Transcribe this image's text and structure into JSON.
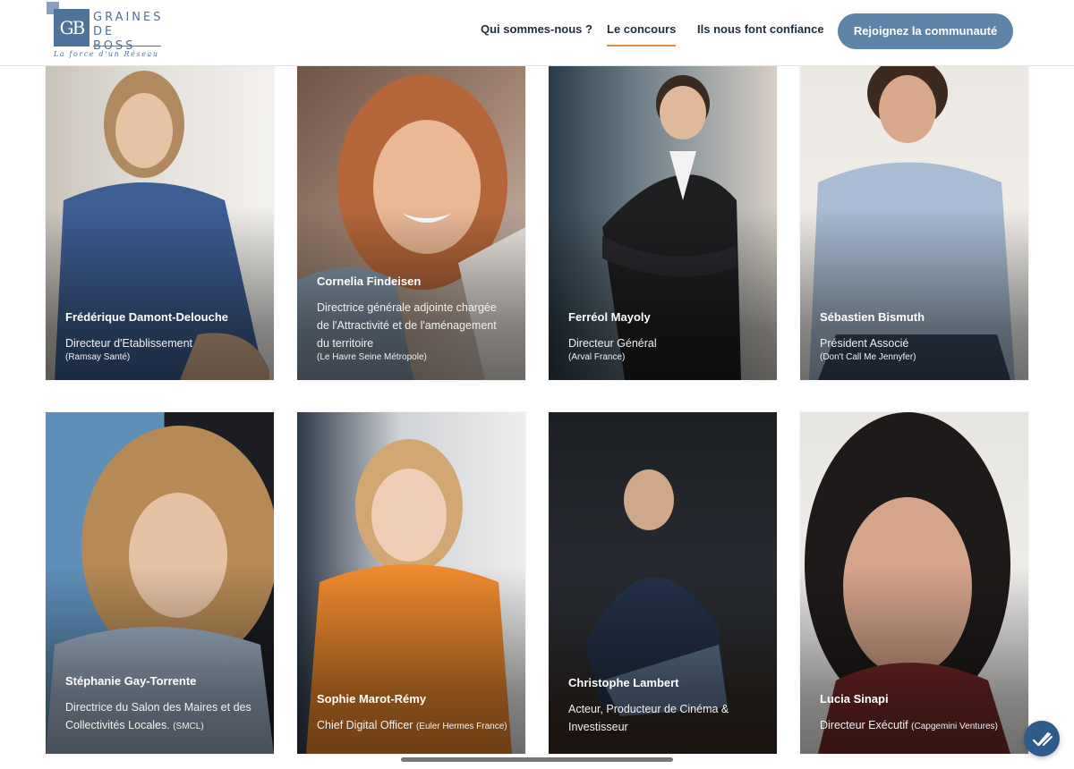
{
  "header": {
    "logo": {
      "monogram": "GB",
      "line1": "GRAINES",
      "line2": "DE BOSS",
      "tagline": "La force d'un Réseau"
    },
    "nav": [
      {
        "label": "Qui sommes-nous ?",
        "active": false
      },
      {
        "label": "Le concours",
        "active": true
      },
      {
        "label": "Ils nous font confiance",
        "active": false
      }
    ],
    "cta_label": "Rejoignez la communauté"
  },
  "colors": {
    "brand": "#4f729b",
    "cta": "#5b84a8",
    "nav_active_underline": "#e38b4a",
    "fab": "#2d5b8a"
  },
  "cards": [
    {
      "name": "Frédérique Damont-Delouche",
      "role": "Directeur d'Etablissement",
      "org": "(Ramsay Santé)"
    },
    {
      "name": "Cornelia Findeisen",
      "role": "Directrice générale adjointe chargée de l'Attractivité et de l'aménagement du territoire",
      "org": "(Le Havre Seine Métropole)"
    },
    {
      "name": "Ferréol Mayoly",
      "role": "Directeur Général",
      "org": "(Arval France)"
    },
    {
      "name": "Sébastien Bismuth",
      "role": "Président Associé",
      "org": "(Don't Call Me Jennyfer)"
    },
    {
      "name": "Stéphanie Gay-Torrente",
      "role": "Directrice du Salon des Maires et des Collectivités Locales.",
      "org": "(SMCL)"
    },
    {
      "name": "Sophie Marot-Rémy",
      "role": "Chief Digital Officer",
      "org": "(Euler Hermes France)"
    },
    {
      "name": "Christophe Lambert",
      "role": "Acteur, Producteur de Cinéma & Investisseur",
      "org": ""
    },
    {
      "name": "Lucia Sinapi",
      "role": "Directeur Exécutif",
      "org": "(Capgemini Ventures)"
    }
  ],
  "fab_icon": "accessibility-check-icon"
}
